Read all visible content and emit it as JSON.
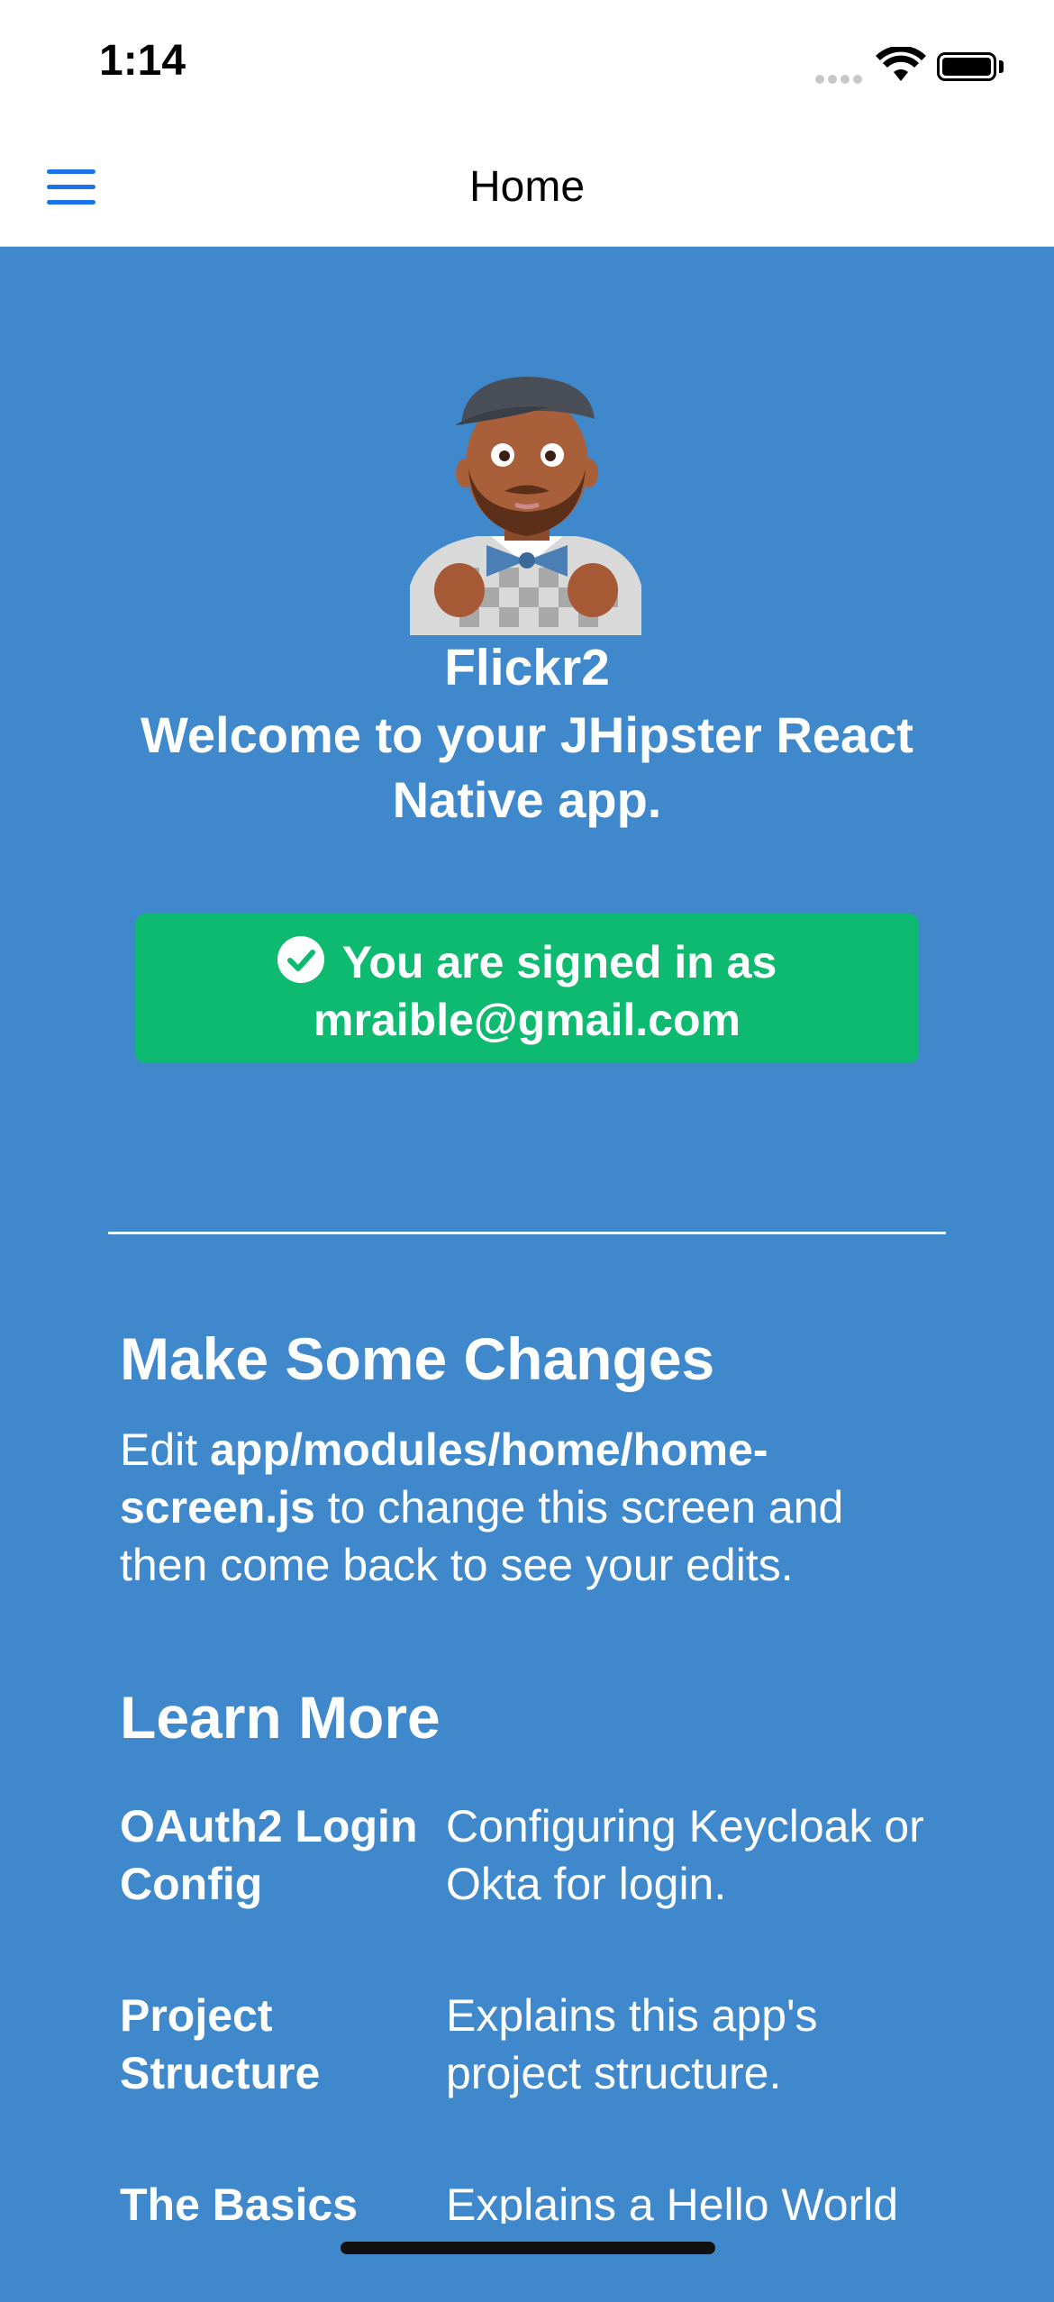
{
  "status_bar": {
    "time": "1:14"
  },
  "nav": {
    "title": "Home"
  },
  "hero": {
    "app_name": "Flickr2",
    "welcome": "Welcome to your JHipster React Native app."
  },
  "auth": {
    "line1": "You are signed in as",
    "email": "mraible@gmail.com"
  },
  "changes": {
    "title": "Make Some Changes",
    "text_before": "Edit ",
    "file_path": "app/modules/home/home-screen.js",
    "text_after": " to change this screen and then come back to see your edits."
  },
  "learn_more": {
    "title": "Learn More",
    "items": [
      {
        "label": "OAuth2 Login Config",
        "description": "Configuring Keycloak or Okta for login."
      },
      {
        "label": "Project Structure",
        "description": "Explains this app's project structure."
      },
      {
        "label": "The Basics",
        "description": "Explains a Hello World"
      }
    ]
  },
  "colors": {
    "background": "#3f88cb",
    "success": "#0eba70",
    "nav_accent": "#1a73e8"
  }
}
